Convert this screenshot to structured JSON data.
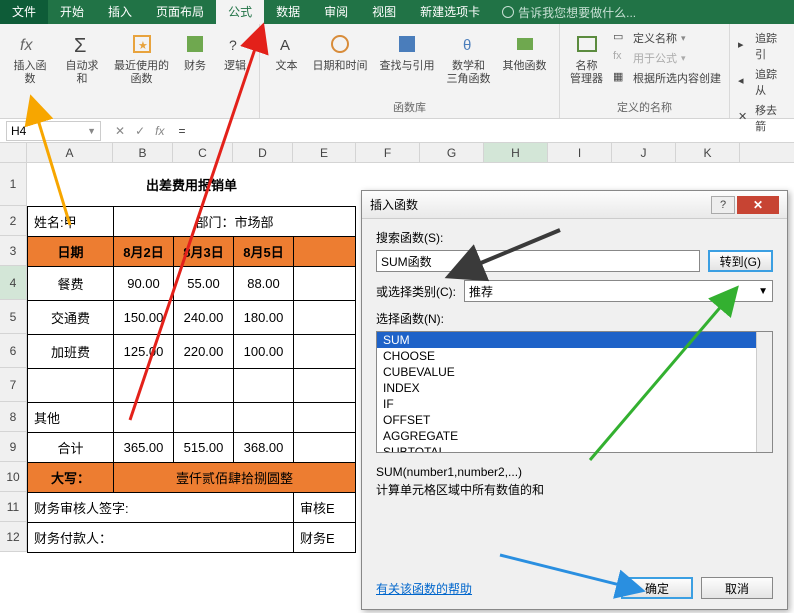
{
  "tabs": {
    "file": "文件",
    "home": "开始",
    "insert": "插入",
    "layout": "页面布局",
    "formula": "公式",
    "data": "数据",
    "review": "审阅",
    "view": "视图",
    "newtab": "新建选项卡",
    "tell": "告诉我您想要做什么..."
  },
  "ribbon": {
    "insert_fn": "插入函数",
    "autosum": "自动求和",
    "recent": "最近使用的\n函数",
    "finance": "财务",
    "logic": "逻辑",
    "text": "文本",
    "datetime": "日期和时间",
    "lookup": "查找与引用",
    "math": "数学和\n三角函数",
    "other": "其他函数",
    "group_lib": "函数库",
    "name_mgr": "名称\n管理器",
    "def_name": "定义名称",
    "use_formula": "用于公式",
    "create_sel": "根据所选内容创建",
    "group_names": "定义的名称",
    "trace_p": "追踪引",
    "trace_d": "追踪从",
    "remove_a": "移去箭"
  },
  "namebox": "H4",
  "formula": "=",
  "cols": [
    "A",
    "B",
    "C",
    "D",
    "E",
    "F",
    "G",
    "H",
    "I",
    "J",
    "K"
  ],
  "rows": [
    "1",
    "2",
    "3",
    "4",
    "5",
    "6",
    "7",
    "8",
    "9",
    "10",
    "11",
    "12"
  ],
  "table": {
    "title": "出差费用报销单",
    "name_lbl": "姓名:甲",
    "dept_lbl": "部门：市场部",
    "hdr_date": "日期",
    "hdr_d1": "8月2日",
    "hdr_d2": "8月3日",
    "hdr_d3": "8月5日",
    "row_meal": "餐费",
    "row_trans": "交通费",
    "row_ot": "加班费",
    "row_other": "其他",
    "row_total": "合计",
    "meal": [
      "90.00",
      "55.00",
      "88.00"
    ],
    "trans": [
      "150.00",
      "240.00",
      "180.00"
    ],
    "ot": [
      "125.00",
      "220.00",
      "100.00"
    ],
    "total": [
      "365.00",
      "515.00",
      "368.00"
    ],
    "upper_lbl": "大写：",
    "upper_val": "壹仟贰佰肆拾捌圆整",
    "sign1": "财务审核人签字:",
    "sign1b": "审核E",
    "sign2": "财务付款人：",
    "sign2b": "财务E"
  },
  "dialog": {
    "title": "插入函数",
    "search_lbl": "搜索函数(S):",
    "search_val": "SUM函数",
    "goto": "转到(G)",
    "cat_lbl": "或选择类别(C):",
    "cat_val": "推荐",
    "sel_lbl": "选择函数(N):",
    "opts": [
      "SUM",
      "CHOOSE",
      "CUBEVALUE",
      "INDEX",
      "IF",
      "OFFSET",
      "AGGREGATE",
      "SUBTOTAL"
    ],
    "sig": "SUM(number1,number2,...)",
    "desc": "计算单元格区域中所有数值的和",
    "help": "有关该函数的帮助",
    "ok": "确定",
    "cancel": "取消",
    "help_q": "?"
  }
}
